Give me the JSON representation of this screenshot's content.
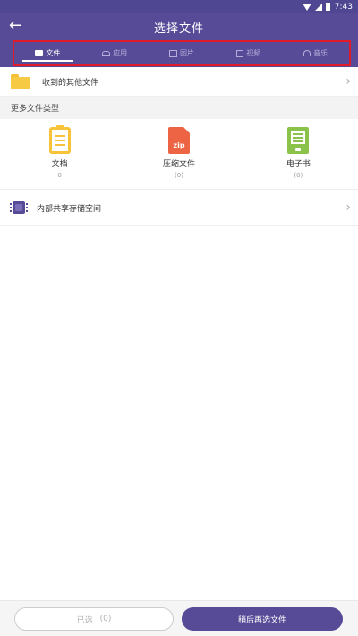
{
  "status_bar": {
    "time": "7:43"
  },
  "header": {
    "back_icon": "arrow-left-icon",
    "title": "选择文件"
  },
  "tabs": [
    {
      "label": "文件",
      "icon": "folder-icon",
      "active": true
    },
    {
      "label": "应用",
      "icon": "android-icon",
      "active": false
    },
    {
      "label": "图片",
      "icon": "image-icon",
      "active": false
    },
    {
      "label": "视频",
      "icon": "video-icon",
      "active": false
    },
    {
      "label": "音乐",
      "icon": "headphones-icon",
      "active": false
    }
  ],
  "received": {
    "label": "收到的其他文件",
    "chevron": "›"
  },
  "section_title": "更多文件类型",
  "file_types": [
    {
      "name": "文档",
      "count": "0",
      "icon": "document-icon"
    },
    {
      "name": "压缩文件",
      "count": "(0)",
      "icon": "zip-icon",
      "icon_text": "zip"
    },
    {
      "name": "电子书",
      "count": "(0)",
      "icon": "ebook-icon"
    }
  ],
  "storage": {
    "label": "内部共享存储空间",
    "chevron": "›"
  },
  "footer": {
    "selected_label": "已选",
    "selected_count": "(0)",
    "later_button": "稍后再选文件"
  },
  "colors": {
    "primary": "#574b98",
    "tab_frame": "#e21b2a",
    "folder": "#f7ca44",
    "zip": "#ed6444",
    "ebook": "#8bc34a"
  }
}
